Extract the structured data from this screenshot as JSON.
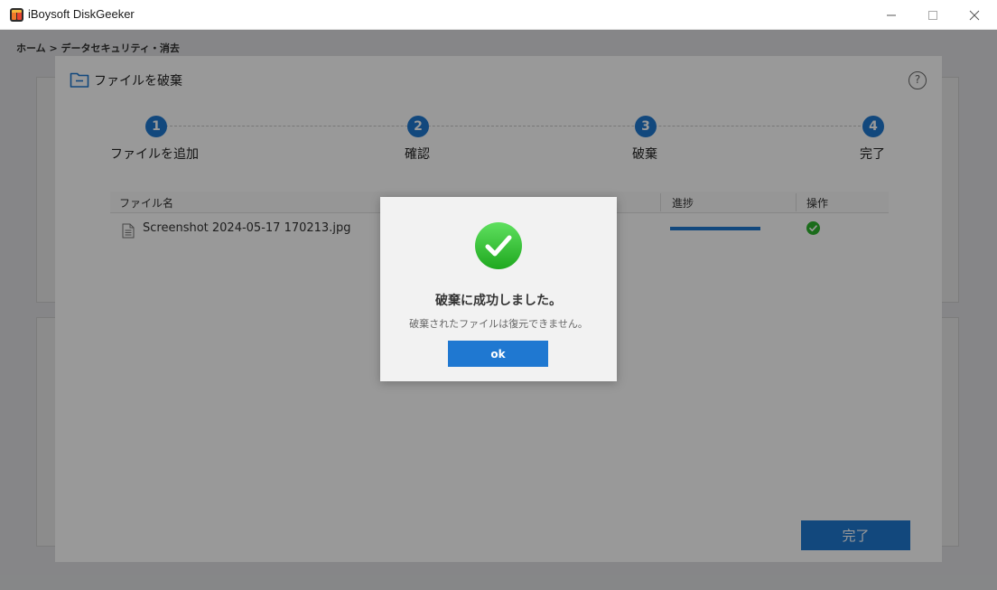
{
  "window": {
    "title": "iBoysoft DiskGeeker",
    "accent_color": "#1f78d1",
    "success_color": "#2db52d"
  },
  "background": {
    "header_text": "ホーム > データセキュリティ・消去"
  },
  "shred_panel": {
    "title": "ファイルを破棄",
    "help": "?",
    "steps": [
      {
        "number": "1",
        "label": "ファイルを追加"
      },
      {
        "number": "2",
        "label": "確認"
      },
      {
        "number": "3",
        "label": "破棄"
      },
      {
        "number": "4",
        "label": "完了"
      }
    ],
    "table": {
      "headers": {
        "file_name": "ファイル名",
        "progress": "進捗",
        "action": "操作"
      },
      "rows": [
        {
          "file_name": "Screenshot 2024-05-17 170213.jpg",
          "progress": 1.0,
          "status_icon": "check-circle-icon"
        }
      ]
    },
    "done_label": "完了"
  },
  "dialog": {
    "icon": "success-check-icon",
    "title": "破棄に成功しました。",
    "message": "破棄されたファイルは復元できません。",
    "ok_label": "ok"
  }
}
